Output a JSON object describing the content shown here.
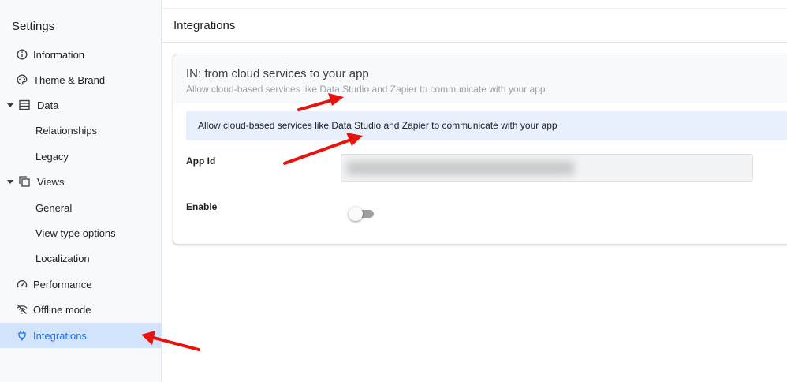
{
  "sidebar": {
    "title": "Settings",
    "items": [
      {
        "label": "Information",
        "icon": "info-icon"
      },
      {
        "label": "Theme & Brand",
        "icon": "palette-icon"
      },
      {
        "label": "Data",
        "icon": "table-icon",
        "expanded": true
      },
      {
        "label": "Relationships"
      },
      {
        "label": "Legacy"
      },
      {
        "label": "Views",
        "icon": "views-icon",
        "expanded": true
      },
      {
        "label": "General"
      },
      {
        "label": "View type options"
      },
      {
        "label": "Localization"
      },
      {
        "label": "Performance",
        "icon": "speedometer-icon"
      },
      {
        "label": "Offline mode",
        "icon": "wifi-off-icon"
      },
      {
        "label": "Integrations",
        "icon": "plug-icon",
        "active": true
      }
    ]
  },
  "header": {
    "title": "Integrations"
  },
  "card": {
    "title": "IN: from cloud services to your app",
    "subtitle": "Allow cloud-based services like Data Studio and Zapier to communicate with your app.",
    "banner": "Allow cloud-based services like Data Studio and Zapier to communicate with your app",
    "app_id_label": "App Id",
    "enable_label": "Enable",
    "enable_on": false
  },
  "colors": {
    "accent": "#1a73e8",
    "active_bg": "#d2e3fc",
    "annotation_arrow": "#e8130d"
  }
}
